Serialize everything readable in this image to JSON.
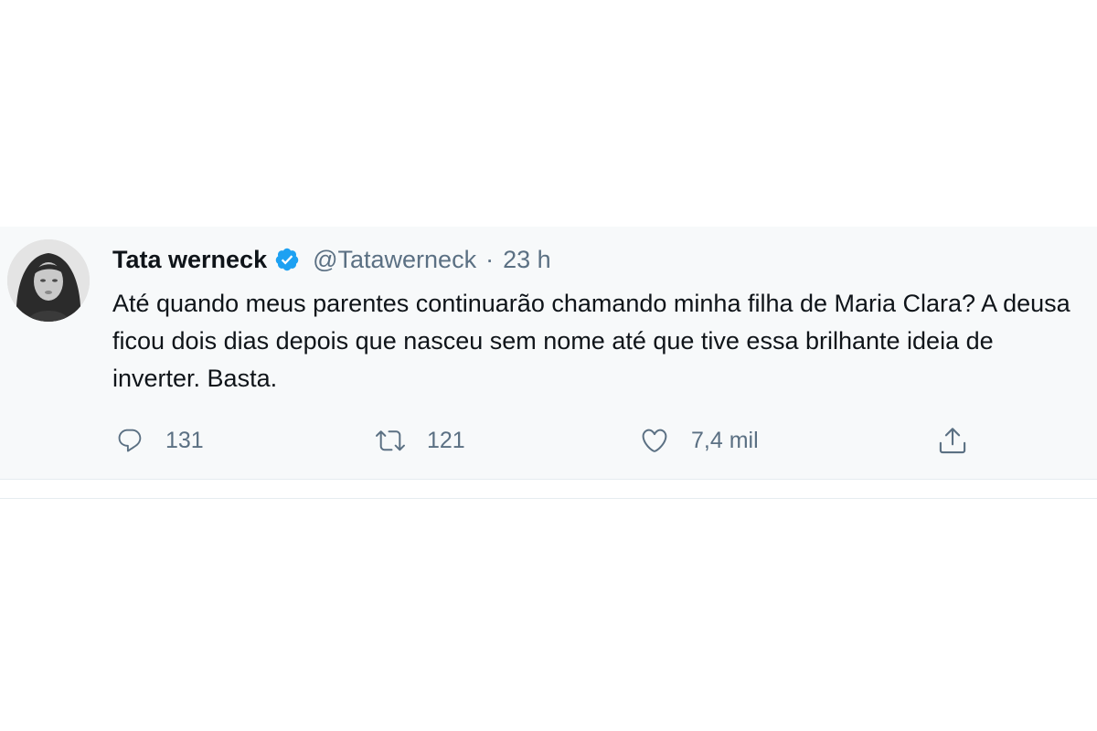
{
  "tweet": {
    "display_name": "Tata werneck",
    "handle": "@Tatawerneck",
    "separator": "·",
    "timestamp": "23 h",
    "verified": true,
    "text": "Até quando meus parentes continuarão chamando minha filha de Maria Clara? A deusa ficou dois dias depois que nasceu sem nome até que tive essa brilhante ideia de inverter. Basta.",
    "actions": {
      "reply_count": "131",
      "retweet_count": "121",
      "like_count": "7,4 mil"
    }
  },
  "icons": {
    "verified": "verified-badge-icon",
    "reply": "reply-bubble-icon",
    "retweet": "retweet-arrows-icon",
    "like": "heart-icon",
    "share": "share-upload-icon"
  },
  "colors": {
    "verified_blue": "#1da1f2",
    "secondary_text": "#5b7083",
    "primary_text": "#0f1419",
    "tweet_background": "#f7f9fa"
  }
}
